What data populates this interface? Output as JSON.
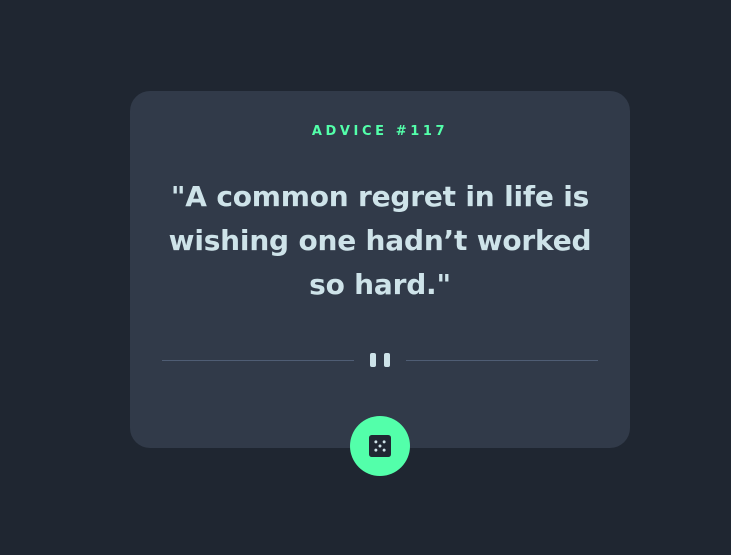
{
  "card": {
    "advice_id": "ADVICE #117",
    "advice_text": "\"A common regret in life is wishing one hadn’t worked so hard.\""
  },
  "divider": {
    "icon": "pause-icon"
  },
  "dice_button": {
    "icon": "dice-icon"
  },
  "colors": {
    "background": "#1f2631",
    "card": "#313a49",
    "accent": "#53ffaa",
    "text": "#cee3e9",
    "divider": "#4f5d74"
  }
}
